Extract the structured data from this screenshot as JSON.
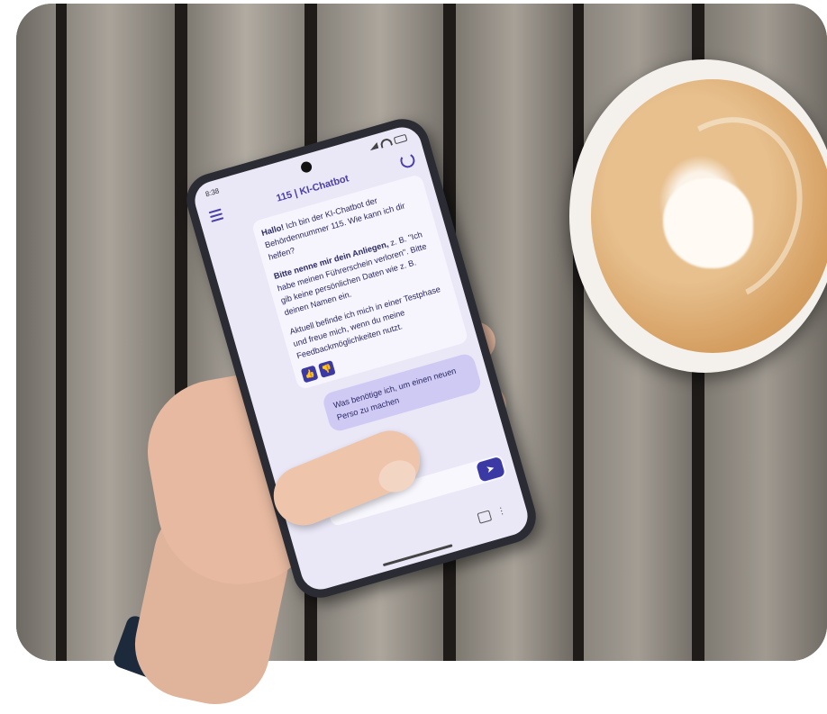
{
  "phone": {
    "status_time": "8:38",
    "app_title": "115 | KI-Chatbot",
    "bot_message": {
      "greeting_bold": "Hallo!",
      "greeting_rest": " Ich bin der KI-Chatbot der Behördennummer 115. Wie kann ich dir helfen?",
      "request_bold": "Bitte nenne mir dein Anliegen,",
      "request_rest": " z. B. \"Ich habe meinen Führerschein verloren\". Bitte gib keine persönlichen Daten wie z. B. deinen Namen ein.",
      "testphase": "Aktuell befinde ich mich in einer Testphase und freue mich, wenn du meine Feedbackmöglichkeiten nutzt."
    },
    "user_message": "Was benötige ich, um einen neuen Perso zu machen",
    "icons": {
      "menu": "menu-icon",
      "refresh": "refresh-icon",
      "thumbs_up": "thumbs-up-icon",
      "thumbs_down": "thumbs-down-icon",
      "send": "send-icon"
    }
  },
  "colors": {
    "accent": "#3b3aa5",
    "screen_bg": "#eae8f7",
    "user_bubble": "#cfcaf3"
  }
}
